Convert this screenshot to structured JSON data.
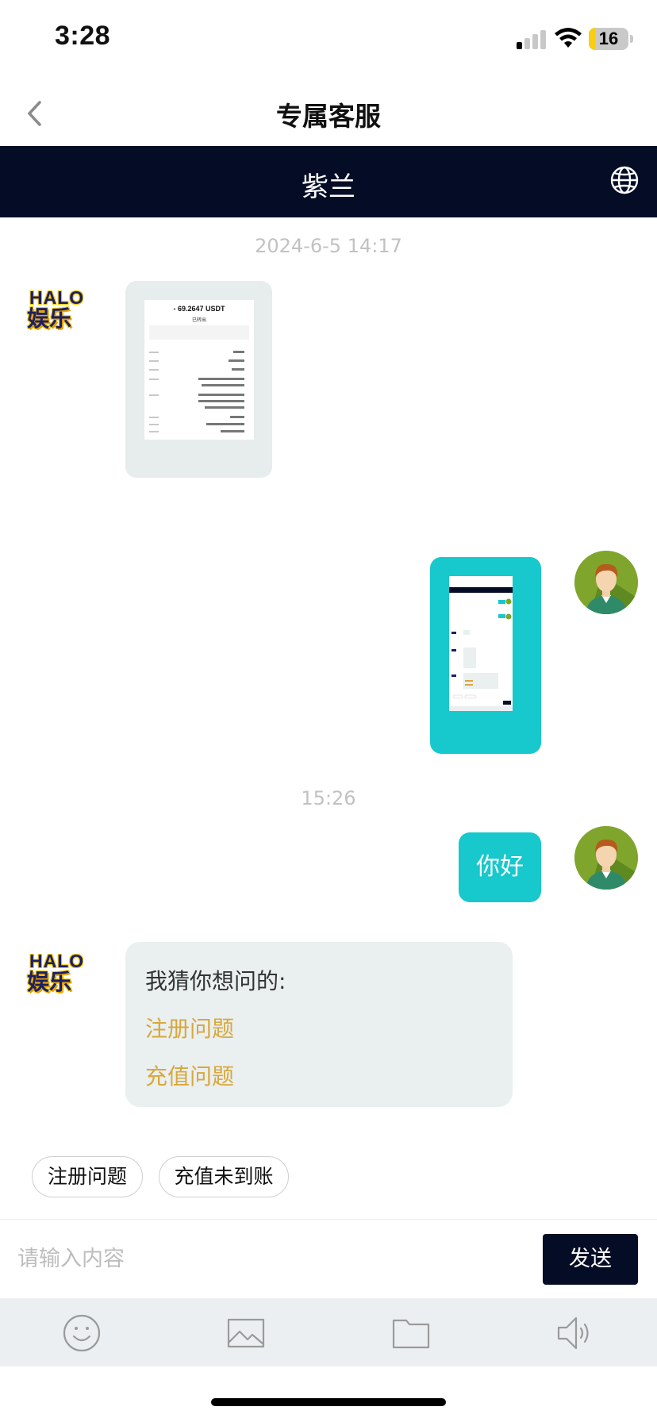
{
  "status_bar": {
    "time": "3:28",
    "battery": "16",
    "battery_level": 0.16
  },
  "nav": {
    "title": "专属客服",
    "back_icon": "chevron-left-icon"
  },
  "agent_bar": {
    "name": "紫兰",
    "language_icon": "globe-icon"
  },
  "messages": {
    "timestamp_1": "2024-6-5 14:17",
    "agent_logo": {
      "line1": "HALO",
      "line2": "娱乐"
    },
    "receipt_image": {
      "amount": "- 69.2647 USDT",
      "status": "已转出"
    },
    "timestamp_2": "15:26",
    "user_text": "你好",
    "faq": {
      "title": "我猜你想问的:",
      "links": [
        "注册问题",
        "充值问题"
      ]
    }
  },
  "quick_replies": [
    "注册问题",
    "充值未到账"
  ],
  "composer": {
    "placeholder": "请输入内容",
    "send_label": "发送"
  },
  "toolbar": {
    "icons": [
      "emoji-icon",
      "image-icon",
      "folder-icon",
      "speaker-icon"
    ]
  },
  "colors": {
    "navy": "#050c25",
    "teal": "#17c8cc",
    "gold_link": "#d8a83a",
    "bubble_grey": "#eaeff0"
  }
}
